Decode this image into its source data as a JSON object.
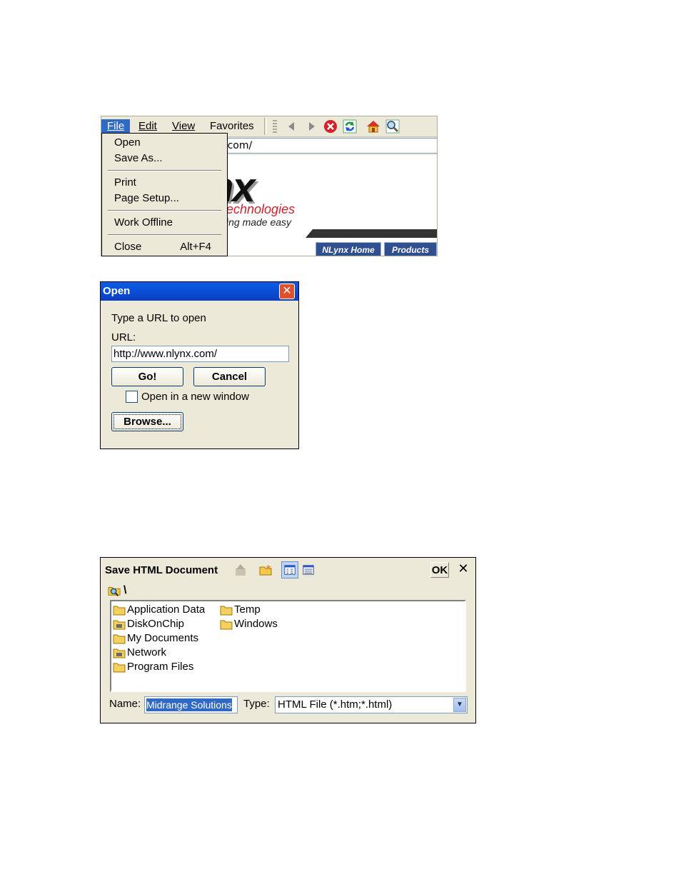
{
  "browser": {
    "menubar": {
      "items": [
        {
          "label": "File"
        },
        {
          "label": "Edit"
        },
        {
          "label": "View"
        },
        {
          "label": "Favorites"
        }
      ]
    },
    "address_text": "nx.com/",
    "logo": {
      "word": "nx",
      "subtitle": "echnologies",
      "tagline": "ing made easy"
    },
    "site_tabs": [
      {
        "label": "NLynx Home"
      },
      {
        "label": "Products"
      }
    ],
    "file_menu": {
      "open": "Open",
      "save_as": "Save As...",
      "print": "Print",
      "page_setup": "Page Setup...",
      "work_offline": "Work Offline",
      "close": "Close",
      "close_shortcut": "Alt+F4"
    },
    "toolbar_icons": [
      "back-icon",
      "forward-icon",
      "stop-icon",
      "refresh-icon",
      "home-icon",
      "search-icon"
    ],
    "colors": {
      "menu_highlight": "#316ac5",
      "stop_red": "#d8202a"
    }
  },
  "open_dialog": {
    "title": "Open",
    "prompt": "Type a URL to open",
    "url_label": "URL:",
    "url_value": "http://www.nlynx.com/",
    "go_label": "Go!",
    "cancel_label": "Cancel",
    "new_window_label": "Open in a new window",
    "new_window_checked": false,
    "browse_label": "Browse..."
  },
  "save_dialog": {
    "title": "Save HTML Document",
    "ok_label": "OK",
    "close_label": "✕",
    "path": "\\",
    "files": [
      {
        "name": "Application Data",
        "icon": "folder-icon"
      },
      {
        "name": "DiskOnChip",
        "icon": "storage-folder-icon"
      },
      {
        "name": "My Documents",
        "icon": "folder-icon"
      },
      {
        "name": "Network",
        "icon": "storage-folder-icon"
      },
      {
        "name": "Program Files",
        "icon": "folder-icon"
      },
      {
        "name": "Temp",
        "icon": "folder-icon"
      },
      {
        "name": "Windows",
        "icon": "folder-icon"
      }
    ],
    "name_label": "Name:",
    "name_value": "Midrange Solutions",
    "type_label": "Type:",
    "type_value": "HTML File (*.htm;*.html)"
  }
}
